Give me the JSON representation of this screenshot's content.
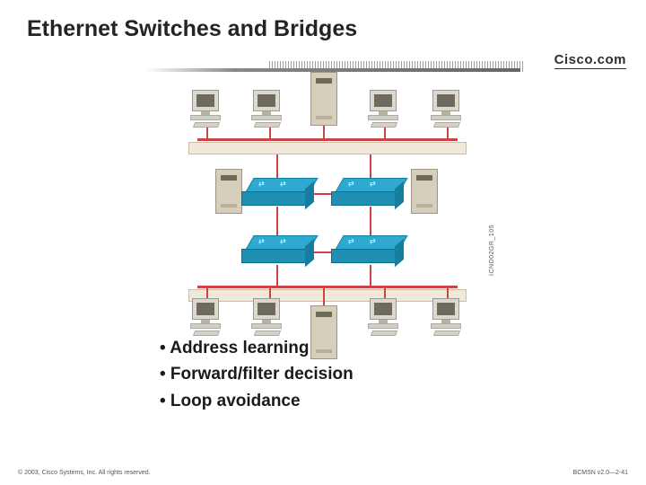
{
  "title": "Ethernet Switches and Bridges",
  "logo": "Cisco.com",
  "diagram_caption": "ICND02GR_105",
  "bullets": {
    "b1": "• Address learning",
    "b2": "• Forward/filter decision",
    "b3": "• Loop avoidance"
  },
  "footer": {
    "copyright": "© 2003, Cisco Systems, Inc. All rights reserved.",
    "slidenum": "BCMSN v2.0—2-41"
  }
}
